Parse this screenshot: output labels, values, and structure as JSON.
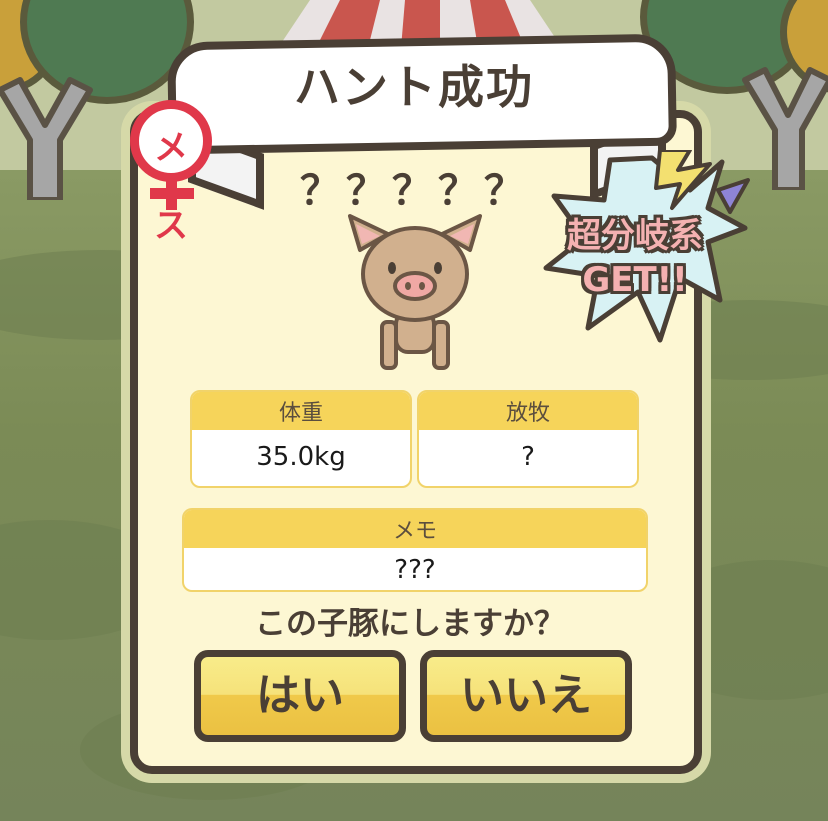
{
  "dialog": {
    "title": "ハント成功",
    "gender_label": "メス",
    "pig_name": "？？？？？",
    "badge": {
      "line1": "超分岐系",
      "line2": "GET!!"
    },
    "fields": {
      "weight": {
        "label": "体重",
        "value": "35.0kg"
      },
      "grazing": {
        "label": "放牧",
        "value": "?"
      },
      "memo": {
        "label": "メモ",
        "value": "???"
      }
    },
    "question": "この子豚にしますか？",
    "buttons": {
      "yes": "はい",
      "no": "いいえ"
    }
  },
  "icons": [
    "female-symbol-icon",
    "pig-icon",
    "lightning-icon",
    "starburst-icon"
  ],
  "colors": {
    "panel_bg": "#fdf7d3",
    "outline": "#4a3f35",
    "field_header": "#f6d45a",
    "button_top": "#f8ec8a",
    "button_bottom": "#ebc142",
    "female_red": "#e0384a",
    "badge_text": "#f4b1b1"
  }
}
